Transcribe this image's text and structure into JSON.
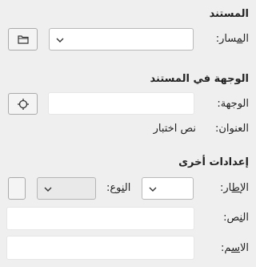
{
  "document_section": {
    "title": "المستند",
    "path_label_pre": "ال",
    "path_label_u": "م",
    "path_label_post": "سار:",
    "browse_icon": "folder-icon"
  },
  "target_section": {
    "title": "الوجهة في المستند",
    "target_label": "الوجهة:",
    "pick_icon": "crosshair-icon",
    "address_label": "العنوان:",
    "address_value": "نص اختبار"
  },
  "other_section": {
    "title": "إعدادات أخرى",
    "frame_label_pre": "الإ",
    "frame_label_u": "ط",
    "frame_label_post": "ار:",
    "type_label_pre": "ال",
    "type_label_u": "ن",
    "type_label_post": "وع:",
    "text_label_pre": "ال",
    "text_label_u": "ن",
    "text_label_post": "ص:",
    "name_label_pre": "الا",
    "name_label_u": "س",
    "name_label_post": "م:"
  }
}
